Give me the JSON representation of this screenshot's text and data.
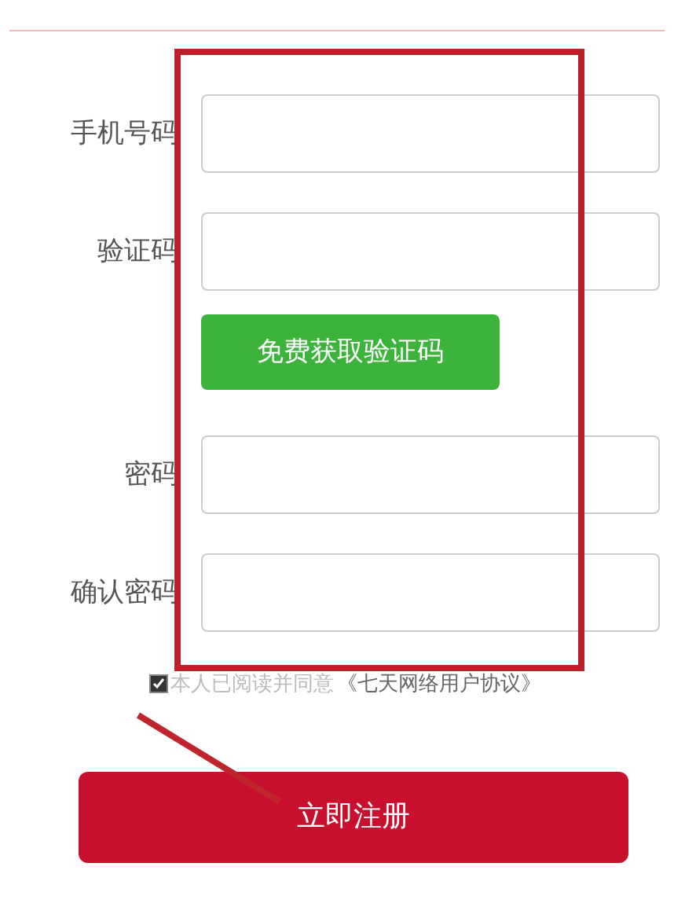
{
  "fields": [
    {
      "label": "手机号码",
      "kind": "input"
    },
    {
      "label": "验证码",
      "kind": "input"
    },
    {
      "label": "免费获取验证码",
      "kind": "button"
    },
    {
      "label": "密码",
      "kind": "input"
    },
    {
      "label": "确认密码",
      "kind": "input"
    }
  ],
  "agreement": {
    "checked": true,
    "text": "本人已阅读并同意",
    "link": "《七天网络用户协议》"
  },
  "submit": "立即注册"
}
